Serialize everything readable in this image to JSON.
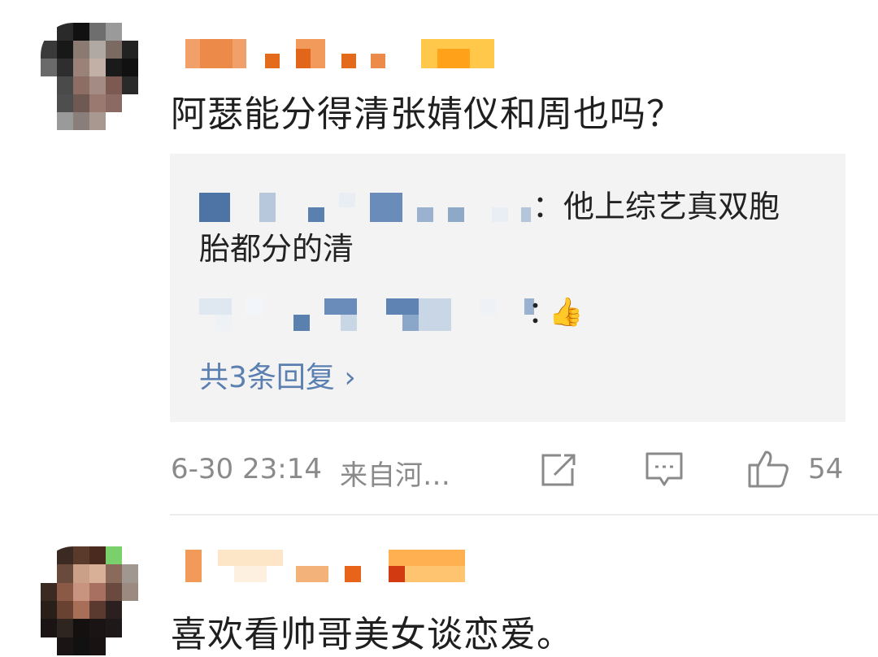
{
  "comments": [
    {
      "text": "阿瑟能分得清张婧仪和周也吗？",
      "replies": [
        {
          "text_line1": "：他上综艺真双胞",
          "text_line2": "胎都分的清"
        },
        {
          "text": "："
        }
      ],
      "reply_emoji": "👍",
      "view_replies_label": "共3条回复 ›",
      "time": "6-30 23:14",
      "source": "来自河…",
      "like_count": "54"
    },
    {
      "text": "喜欢看帅哥美女谈恋爱。"
    }
  ],
  "icons": [
    "avatar-icon",
    "share-icon",
    "comment-icon",
    "thumbs-up-icon",
    "thumbs-up-emoji"
  ]
}
